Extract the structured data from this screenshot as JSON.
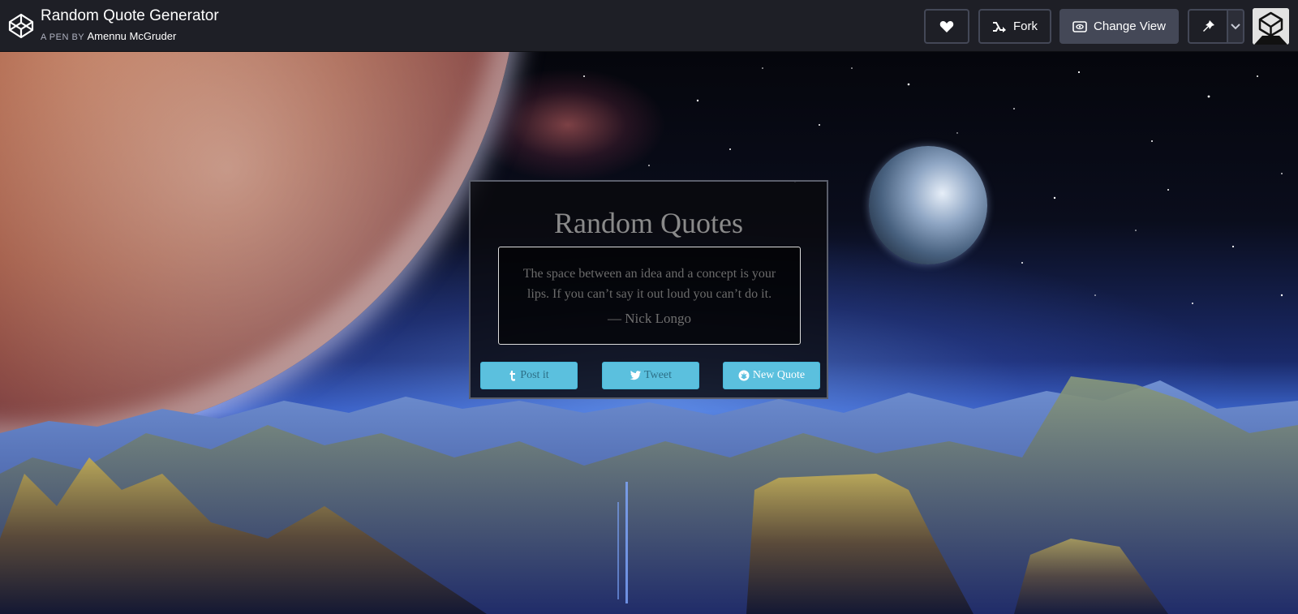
{
  "header": {
    "title": "Random Quote Generator",
    "by_label": "A PEN BY",
    "author": "Amennu McGruder",
    "fork_label": "Fork",
    "change_view_label": "Change View"
  },
  "icons": {
    "logo": "codepen-logo-icon",
    "heart": "heart-icon",
    "fork": "fork-icon",
    "view": "eye-icon",
    "pin": "pin-icon",
    "menu": "chevron-down-icon",
    "avatar": "codepen-avatar-icon",
    "post": "tumblr-icon",
    "tweet": "twitter-icon",
    "new_quote": "rebel-icon"
  },
  "card": {
    "title": "Random Quotes",
    "quote": "The space between an idea and a concept is your lips. If you can’t say it out loud you can’t do it.",
    "author": "— Nick Longo",
    "post_label": "Post it",
    "tweet_label": "Tweet",
    "new_quote_label": "New Quote"
  },
  "colors": {
    "topbar": "#1e1f26",
    "button_border": "#444857",
    "card_button": "#5bc0de"
  }
}
